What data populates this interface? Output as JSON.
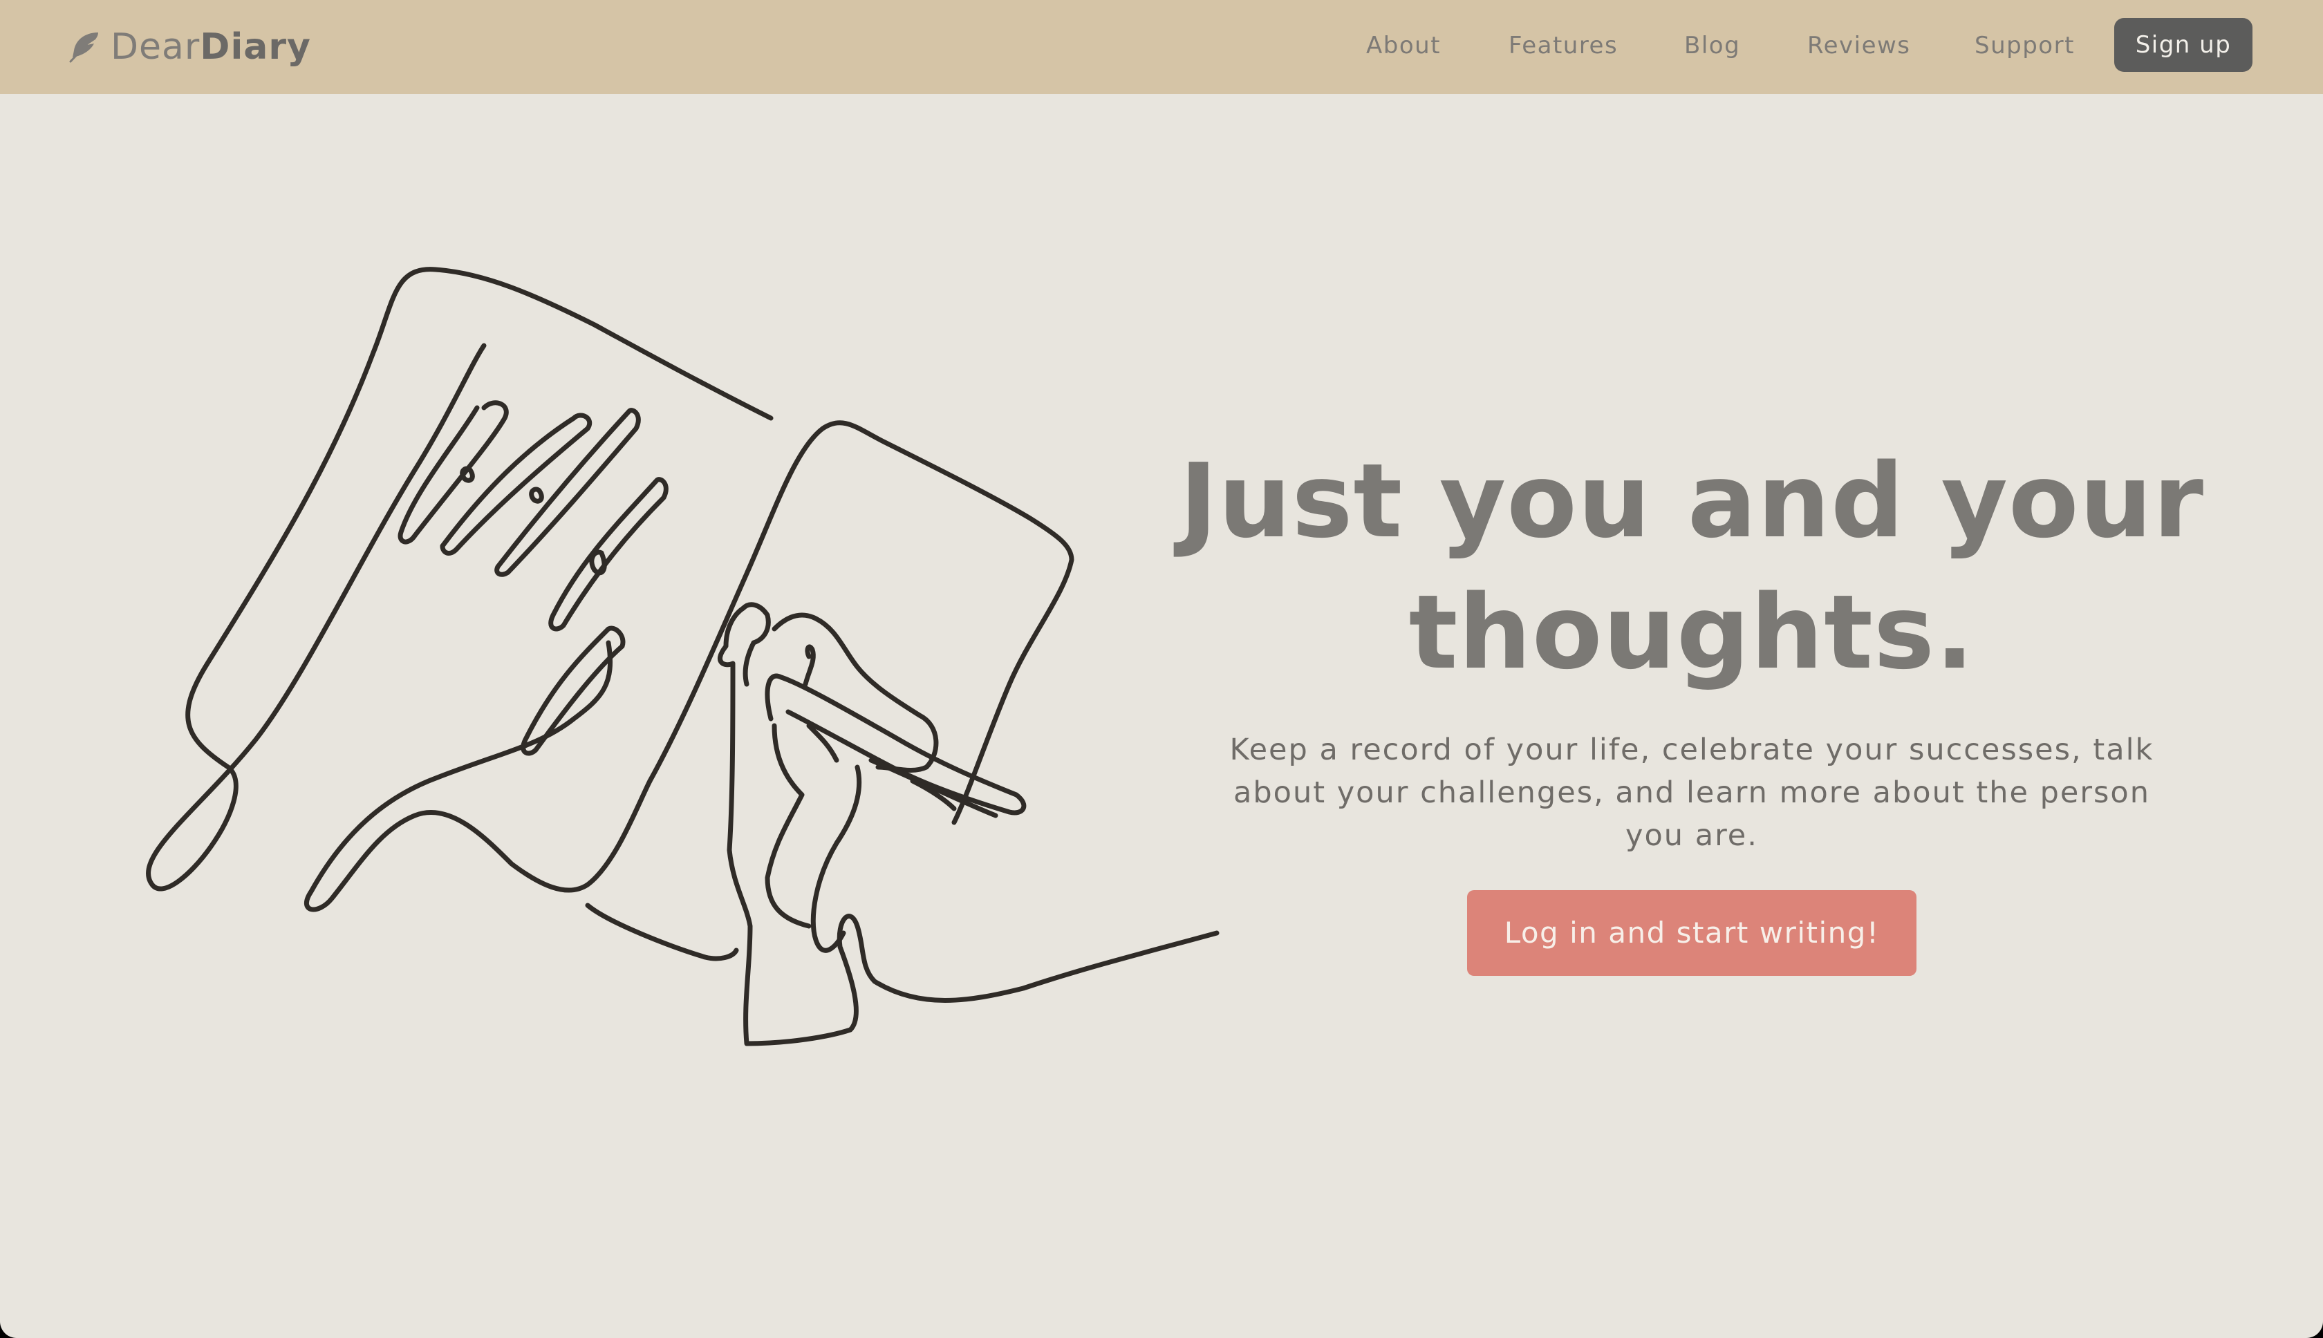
{
  "brand": {
    "name_light": "Dear",
    "name_bold": "Diary",
    "icon": "feather-icon"
  },
  "nav": {
    "links": [
      "About",
      "Features",
      "Blog",
      "Reviews",
      "Support"
    ],
    "signup_label": "Sign up"
  },
  "hero": {
    "headline_line1": "Just you and your",
    "headline_line2": "thoughts.",
    "subtitle": "Keep a record of your life, celebrate your successes, talk about your challenges, and learn more about the person you are.",
    "cta_label": "Log in and start writing!"
  },
  "illustration": {
    "icon": "journal-writing-illustration"
  },
  "colors": {
    "navbar": "#d5c4a6",
    "background": "#e8e5de",
    "cta": "#dc8479",
    "signup": "#5c5c5b"
  }
}
